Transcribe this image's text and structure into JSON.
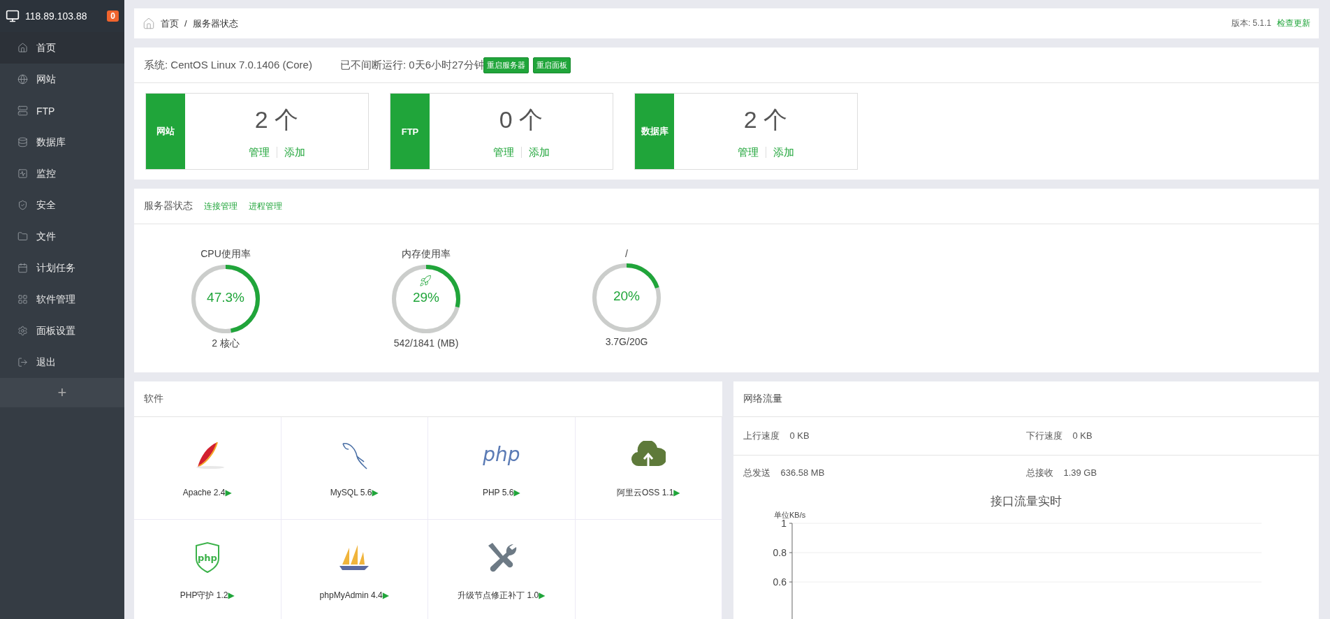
{
  "sidebar": {
    "host": "118.89.103.88",
    "badge": "0",
    "items": [
      {
        "label": "首页",
        "selected": true
      },
      {
        "label": "网站",
        "selected": false
      },
      {
        "label": "FTP",
        "selected": false
      },
      {
        "label": "数据库",
        "selected": false
      },
      {
        "label": "监控",
        "selected": false
      },
      {
        "label": "安全",
        "selected": false
      },
      {
        "label": "文件",
        "selected": false
      },
      {
        "label": "计划任务",
        "selected": false
      },
      {
        "label": "软件管理",
        "selected": false
      },
      {
        "label": "面板设置",
        "selected": false
      },
      {
        "label": "退出",
        "selected": false
      }
    ],
    "add_button": "+"
  },
  "breadcrumb": {
    "items": [
      "首页",
      "服务器状态"
    ],
    "separator": "/",
    "version": "版本: 5.1.1",
    "update_link": "检查更新"
  },
  "system": {
    "os": "系统: CentOS Linux 7.0.1406 (Core)",
    "uptime": "已不间断运行: 0天6小时27分钟",
    "buttons": [
      "重启服务器",
      "重启面板"
    ],
    "cards": [
      {
        "label": "网站",
        "count": "2 个",
        "links": [
          "管理",
          "添加"
        ]
      },
      {
        "label": "FTP",
        "count": "0 个",
        "links": [
          "管理",
          "添加"
        ]
      },
      {
        "label": "数据库",
        "count": "2 个",
        "links": [
          "管理",
          "添加"
        ]
      }
    ]
  },
  "server_status": {
    "title": "服务器状态",
    "links": [
      "连接管理",
      "进程管理"
    ],
    "gauges": [
      {
        "title": "CPU使用率",
        "value": "47.3%",
        "level": 0.473,
        "footer": "2 核心",
        "rocket": false
      },
      {
        "title": "内存使用率",
        "value": "29%",
        "level": 0.29,
        "footer": "542/1841 (MB)",
        "rocket": true
      },
      {
        "title": "/",
        "value": "20%",
        "level": 0.2,
        "footer": "3.7G/20G",
        "rocket": false
      }
    ]
  },
  "software": {
    "title": "软件",
    "items": [
      {
        "name": "Apache 2.4",
        "arrow": "▶"
      },
      {
        "name": "MySQL 5.6",
        "arrow": "▶"
      },
      {
        "name": "PHP 5.6",
        "arrow": "▶",
        "logo_text": "php"
      },
      {
        "name": "阿里云OSS 1.1",
        "arrow": "▶"
      },
      {
        "name": "PHP守护 1.2",
        "arrow": "▶",
        "logo_text": "php"
      },
      {
        "name": "phpMyAdmin 4.4",
        "arrow": "▶"
      },
      {
        "name": "升级节点修正补丁 1.0",
        "arrow": "▶"
      }
    ]
  },
  "network": {
    "title": "网络流量",
    "rows": [
      [
        {
          "label": "上行速度",
          "value": "0 KB"
        },
        {
          "label": "下行速度",
          "value": "0 KB"
        }
      ],
      [
        {
          "label": "总发送",
          "value": "636.58 MB"
        },
        {
          "label": "总接收",
          "value": "1.39 GB"
        }
      ]
    ],
    "chart": {
      "title": "接口流量实时",
      "unit": "单位KB/s",
      "tick_labels": [
        "1",
        "0.8",
        "0.6"
      ]
    }
  }
}
